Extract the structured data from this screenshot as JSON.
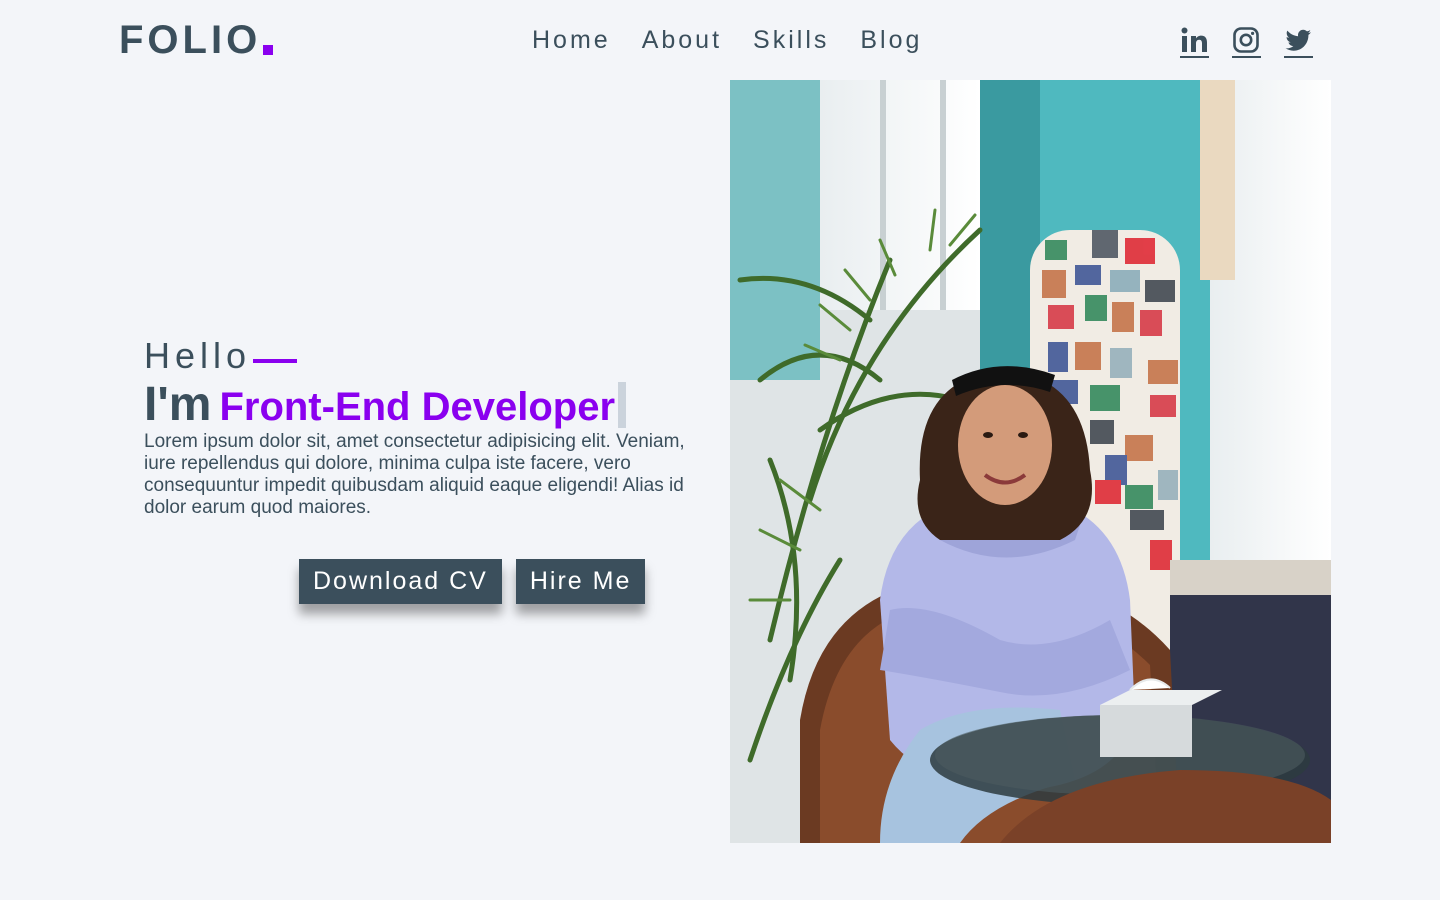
{
  "brand": {
    "name": "FOLIO",
    "accent": "#8a00ef"
  },
  "nav": {
    "items": [
      "Home",
      "About",
      "Skills",
      "Blog"
    ]
  },
  "social": [
    "linkedin-icon",
    "instagram-icon",
    "twitter-icon"
  ],
  "hero": {
    "greeting": "Hello",
    "prefix": "I'm",
    "role": "Front-End Developer",
    "intro": "Lorem ipsum dolor sit, amet consectetur adipisicing elit. Veniam, iure repellendus qui dolore, minima culpa iste facere, vero consequuntur impedit quibusdam aliquid eaque eligendi! Alias id dolor earum quod maiores.",
    "buttons": {
      "download": "Download CV",
      "hire": "Hire Me"
    }
  },
  "colors": {
    "text": "#3b4f5c",
    "background": "#f3f5f9",
    "button": "#3b4f5c"
  }
}
